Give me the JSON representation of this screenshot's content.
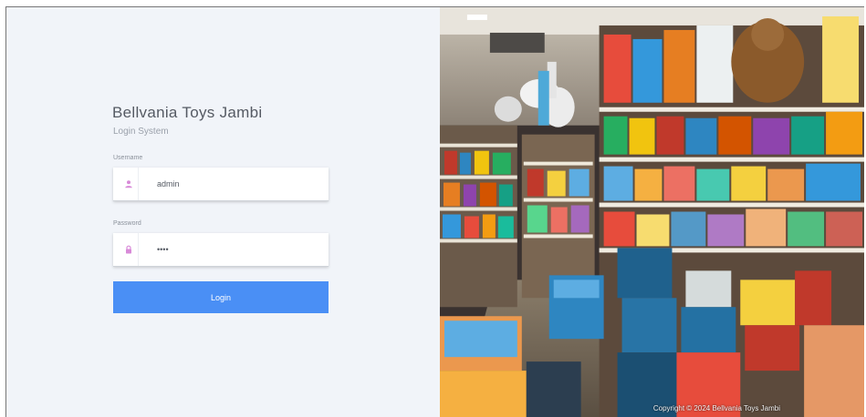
{
  "brand": {
    "title": "Bellvania Toys Jambi",
    "subtitle": "Login System"
  },
  "form": {
    "username_label": "Username",
    "username_value": "admin",
    "username_icon": "user-icon",
    "password_label": "Password",
    "password_value": "••••",
    "password_icon": "lock-icon",
    "login_label": "Login"
  },
  "footer": {
    "copyright": "Copyright © 2024 Bellvania Toys Jambi"
  },
  "colors": {
    "accent": "#4a8ff5",
    "panel_bg": "#f1f4f9",
    "icon_color": "#d88ad8"
  }
}
